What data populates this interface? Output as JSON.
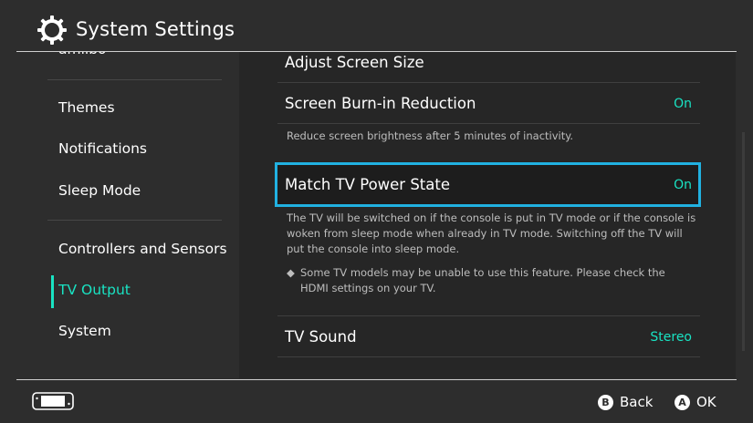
{
  "header": {
    "title": "System Settings",
    "icon": "gear-icon"
  },
  "sidebar": {
    "partial_item": "amiibo",
    "items": [
      {
        "label": "Themes"
      },
      {
        "label": "Notifications"
      },
      {
        "label": "Sleep Mode"
      },
      {
        "label": "Controllers and Sensors"
      },
      {
        "label": "TV Output",
        "active": true
      },
      {
        "label": "System"
      }
    ]
  },
  "main": {
    "adjust_screen_size": {
      "label": "Adjust Screen Size"
    },
    "burn_in": {
      "label": "Screen Burn-in Reduction",
      "value": "On",
      "description": "Reduce screen brightness after 5 minutes of inactivity."
    },
    "match_tv_power": {
      "label": "Match TV Power State",
      "value": "On",
      "description": "The TV will be switched on if the console is put in TV mode or if the console is woken from sleep mode when already in TV mode. Switching off the TV will put the console into sleep mode.",
      "note_bullet": "◆",
      "note": "Some TV models may be unable to use this feature. Please check the HDMI settings on your TV."
    },
    "tv_sound": {
      "label": "TV Sound",
      "value": "Stereo"
    }
  },
  "footer": {
    "b_button": {
      "letter": "B",
      "label": "Back"
    },
    "a_button": {
      "letter": "A",
      "label": "OK"
    },
    "left_icon": "console-icon"
  },
  "colors": {
    "accent": "#19e3c3",
    "selection_border": "#21b1e1",
    "background": "#2d2d2d",
    "panel": "#262626"
  }
}
